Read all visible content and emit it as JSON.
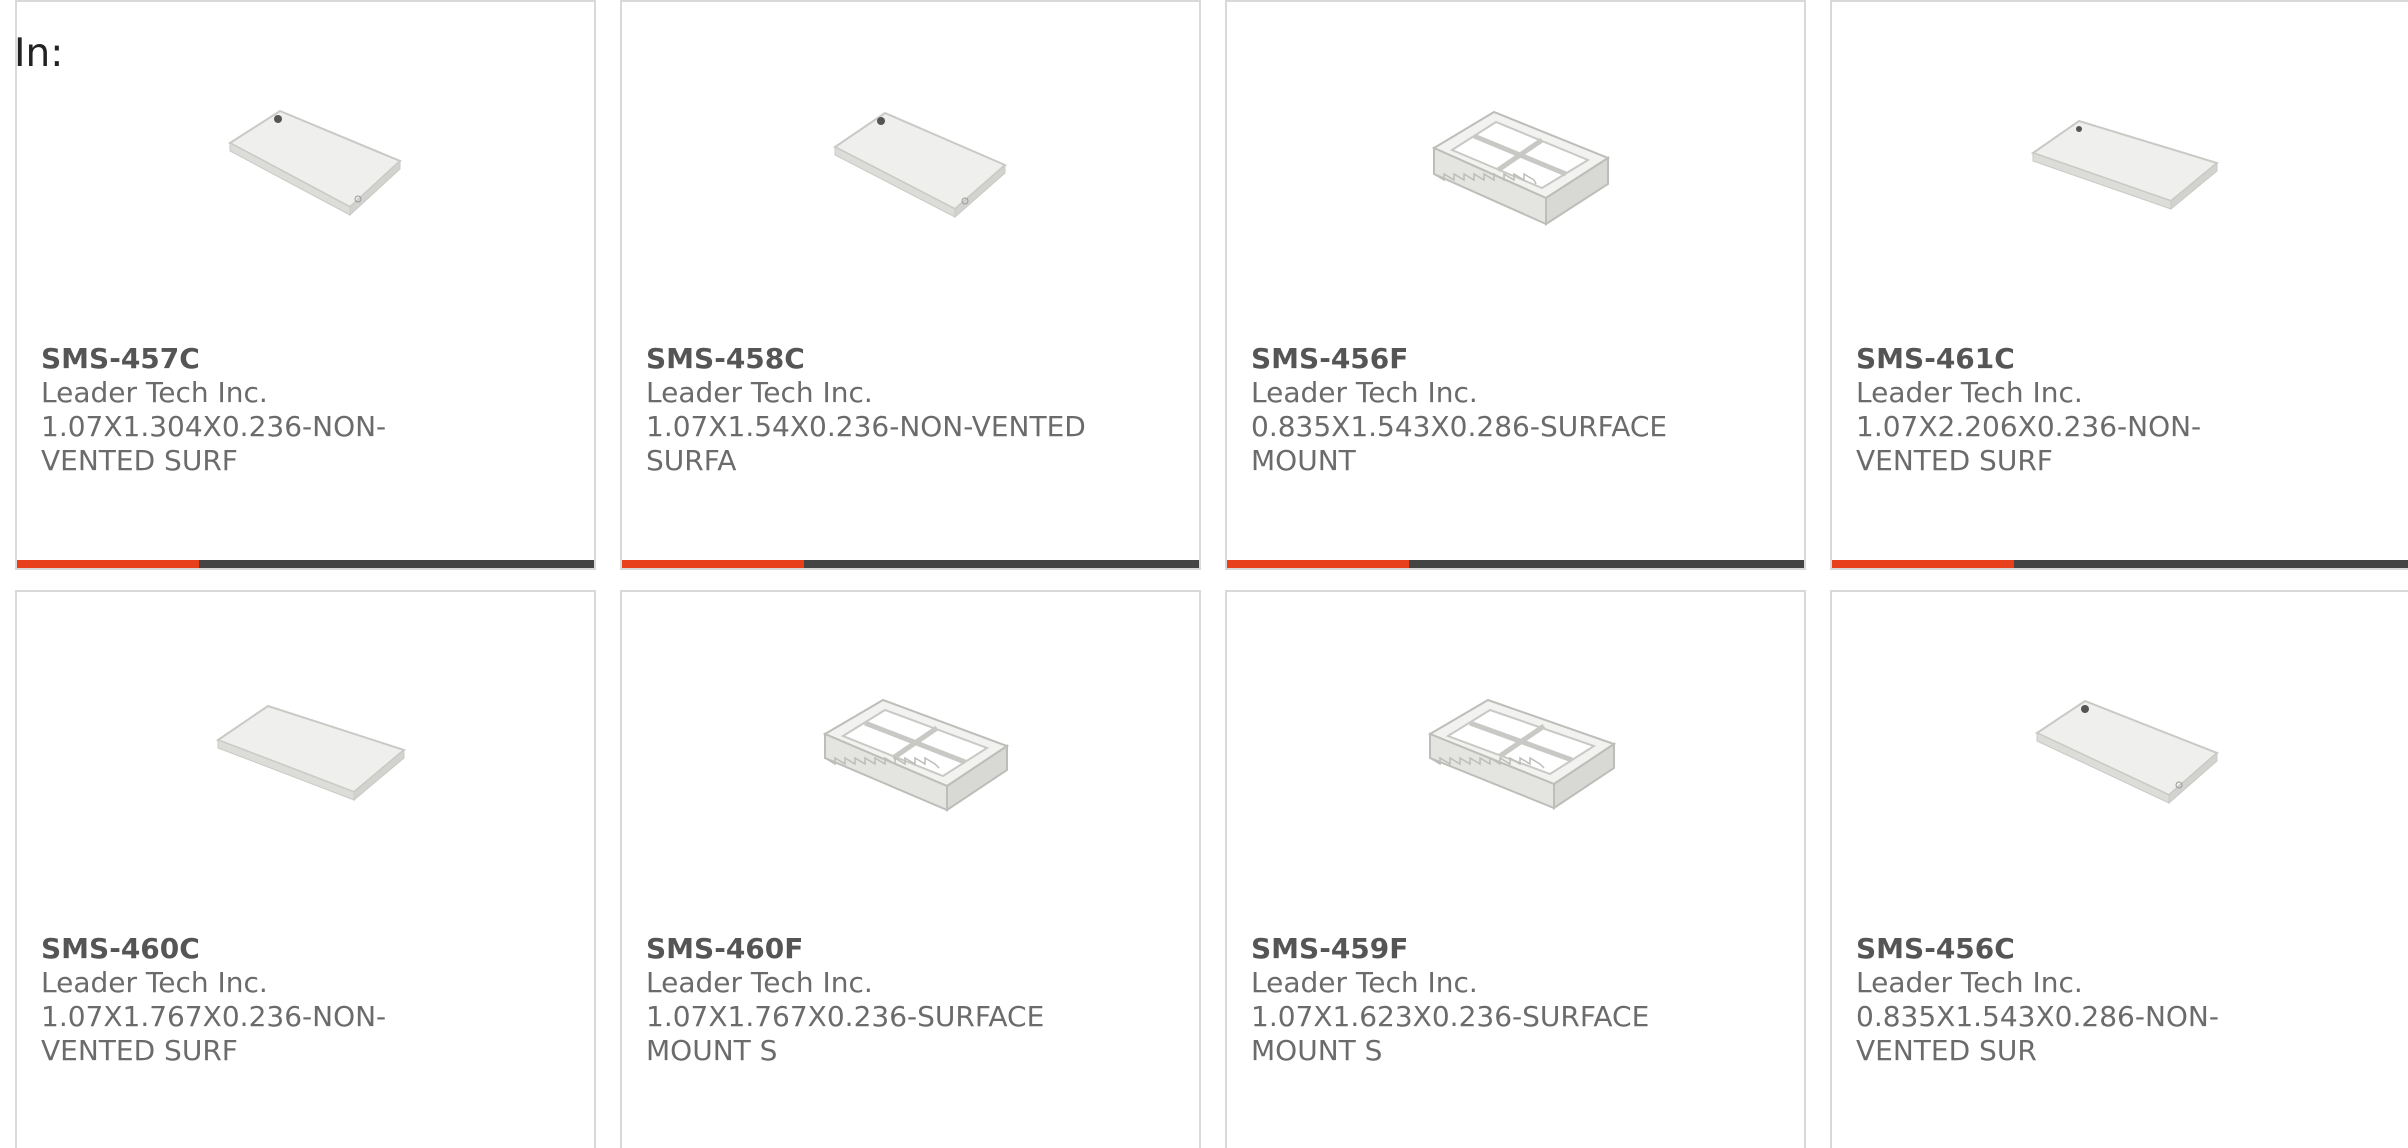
{
  "header": {
    "label": "In:"
  },
  "colors": {
    "accent": "#e8401c",
    "bar": "#444444",
    "border": "#d9d9d9",
    "text": "#6b6b6b"
  },
  "products": [
    {
      "part": "SMS-457C",
      "manufacturer": "Leader Tech Inc.",
      "desc": "1.07X1.304X0.236-NON-VENTED SURF",
      "image": "shield-cover-icon"
    },
    {
      "part": "SMS-458C",
      "manufacturer": "Leader Tech Inc.",
      "desc": "1.07X1.54X0.236-NON-VENTED SURFA",
      "image": "shield-cover-icon"
    },
    {
      "part": "SMS-456F",
      "manufacturer": "Leader Tech Inc.",
      "desc": "0.835X1.543X0.286-SURFACE MOUNT",
      "image": "shield-frame-icon"
    },
    {
      "part": "SMS-461C",
      "manufacturer": "Leader Tech Inc.",
      "desc": "1.07X2.206X0.236-NON-VENTED SURF",
      "image": "shield-cover-icon"
    },
    {
      "part": "SMS-460C",
      "manufacturer": "Leader Tech Inc.",
      "desc": "1.07X1.767X0.236-NON-VENTED SURF",
      "image": "shield-cover-icon"
    },
    {
      "part": "SMS-460F",
      "manufacturer": "Leader Tech Inc.",
      "desc": "1.07X1.767X0.236-SURFACE MOUNT S",
      "image": "shield-frame-icon"
    },
    {
      "part": "SMS-459F",
      "manufacturer": "Leader Tech Inc.",
      "desc": "1.07X1.623X0.236-SURFACE MOUNT S",
      "image": "shield-frame-icon"
    },
    {
      "part": "SMS-456C",
      "manufacturer": "Leader Tech Inc.",
      "desc": "0.835X1.543X0.286-NON-VENTED SUR",
      "image": "shield-cover-icon"
    }
  ]
}
